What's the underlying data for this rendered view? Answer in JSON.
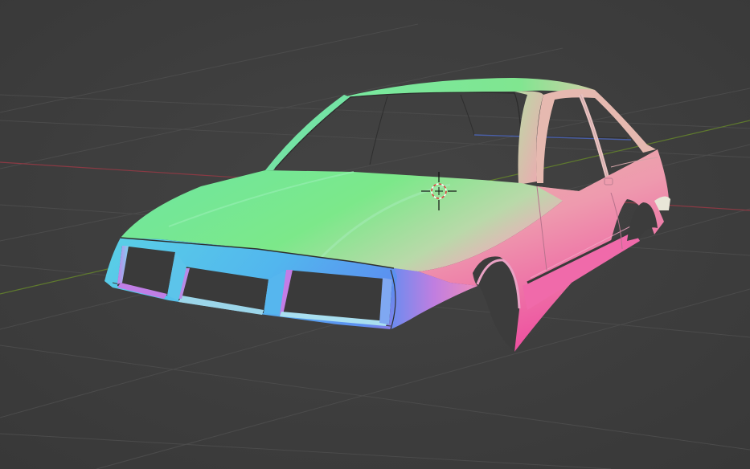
{
  "viewport": {
    "background": "#3d3d3d",
    "grid_color": "#4a4a4a",
    "x_axis_color": "#8a3a44",
    "y_axis_color": "#5f7a2e",
    "object": "car-body-mesh",
    "shading": "normal-map",
    "cursor_icon": "3d-cursor-icon"
  }
}
